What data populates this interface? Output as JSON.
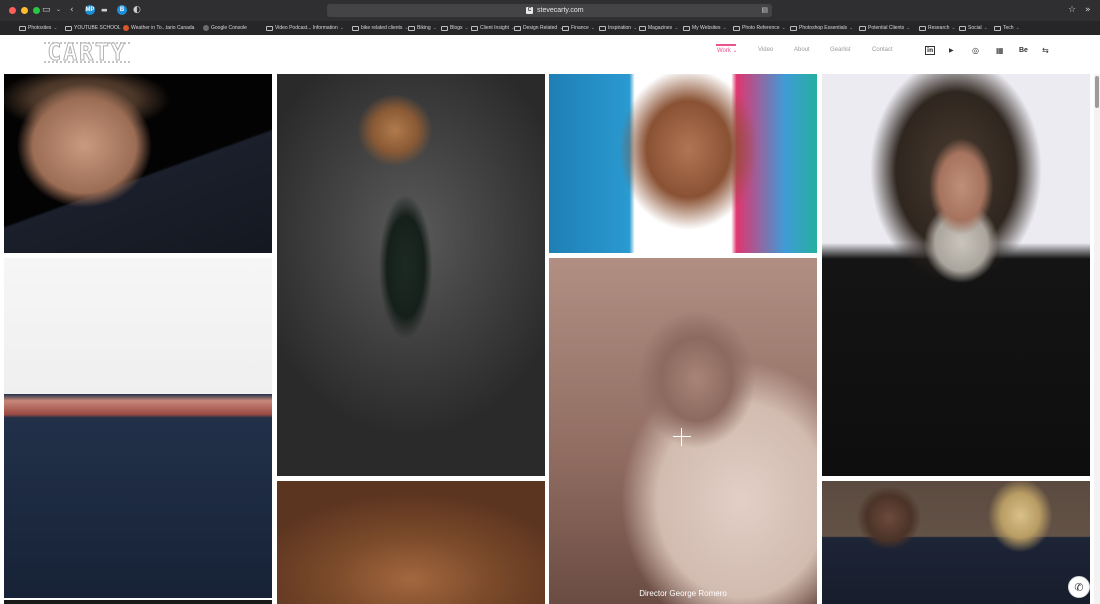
{
  "browser": {
    "url": "stevecarty.com",
    "favicon_letter": "C",
    "pinned_tabs": [
      {
        "label": "MP",
        "color": "#1e8fd6"
      },
      {
        "label": "B",
        "color": "#1e8fd6"
      }
    ],
    "bookmarks": [
      {
        "label": "Photosites",
        "type": "folder"
      },
      {
        "label": "YOUTUBE SCHOOL",
        "type": "folder"
      },
      {
        "label": "Weather in To...tario Canada",
        "type": "site",
        "color": "#d9572b"
      },
      {
        "label": "Google Console",
        "type": "site",
        "color": "#6b6b6b"
      },
      {
        "label": "Video Podcast... Information",
        "type": "folder"
      },
      {
        "label": "bike related clients",
        "type": "folder"
      },
      {
        "label": "Biking",
        "type": "folder"
      },
      {
        "label": "Blogs",
        "type": "folder"
      },
      {
        "label": "Client Insight",
        "type": "folder"
      },
      {
        "label": "Design Related",
        "type": "folder"
      },
      {
        "label": "Finance",
        "type": "folder"
      },
      {
        "label": "Inspiration",
        "type": "folder"
      },
      {
        "label": "Magazines",
        "type": "folder"
      },
      {
        "label": "My Websites",
        "type": "folder"
      },
      {
        "label": "Photo Reference",
        "type": "folder"
      },
      {
        "label": "Photoshop Essentials",
        "type": "folder"
      },
      {
        "label": "Potential Clients",
        "type": "folder"
      },
      {
        "label": "Research",
        "type": "folder"
      },
      {
        "label": "Social",
        "type": "folder"
      },
      {
        "label": "Tech",
        "type": "folder"
      }
    ]
  },
  "site": {
    "logo": "CARTY",
    "nav": [
      {
        "label": "Work",
        "active": true,
        "dropdown": true
      },
      {
        "label": "Video",
        "active": false
      },
      {
        "label": "About",
        "active": false
      },
      {
        "label": "Gearlist",
        "active": false
      },
      {
        "label": "Contact",
        "active": false
      }
    ],
    "social": [
      {
        "icon": "linkedin-icon",
        "glyph": "in"
      },
      {
        "icon": "youtube-icon",
        "glyph": "▶"
      },
      {
        "icon": "instagram-icon",
        "glyph": "◎"
      },
      {
        "icon": "bank-icon",
        "glyph": "▦"
      },
      {
        "icon": "behance-icon",
        "glyph": "Be"
      },
      {
        "icon": "share-icon",
        "glyph": "⇆"
      }
    ],
    "accent_color": "#e8548f"
  },
  "gallery": {
    "hover_caption": "Director George Romero"
  },
  "colors": {
    "chrome": "#2b2b2d",
    "bookmarks_bar": "#262628"
  }
}
